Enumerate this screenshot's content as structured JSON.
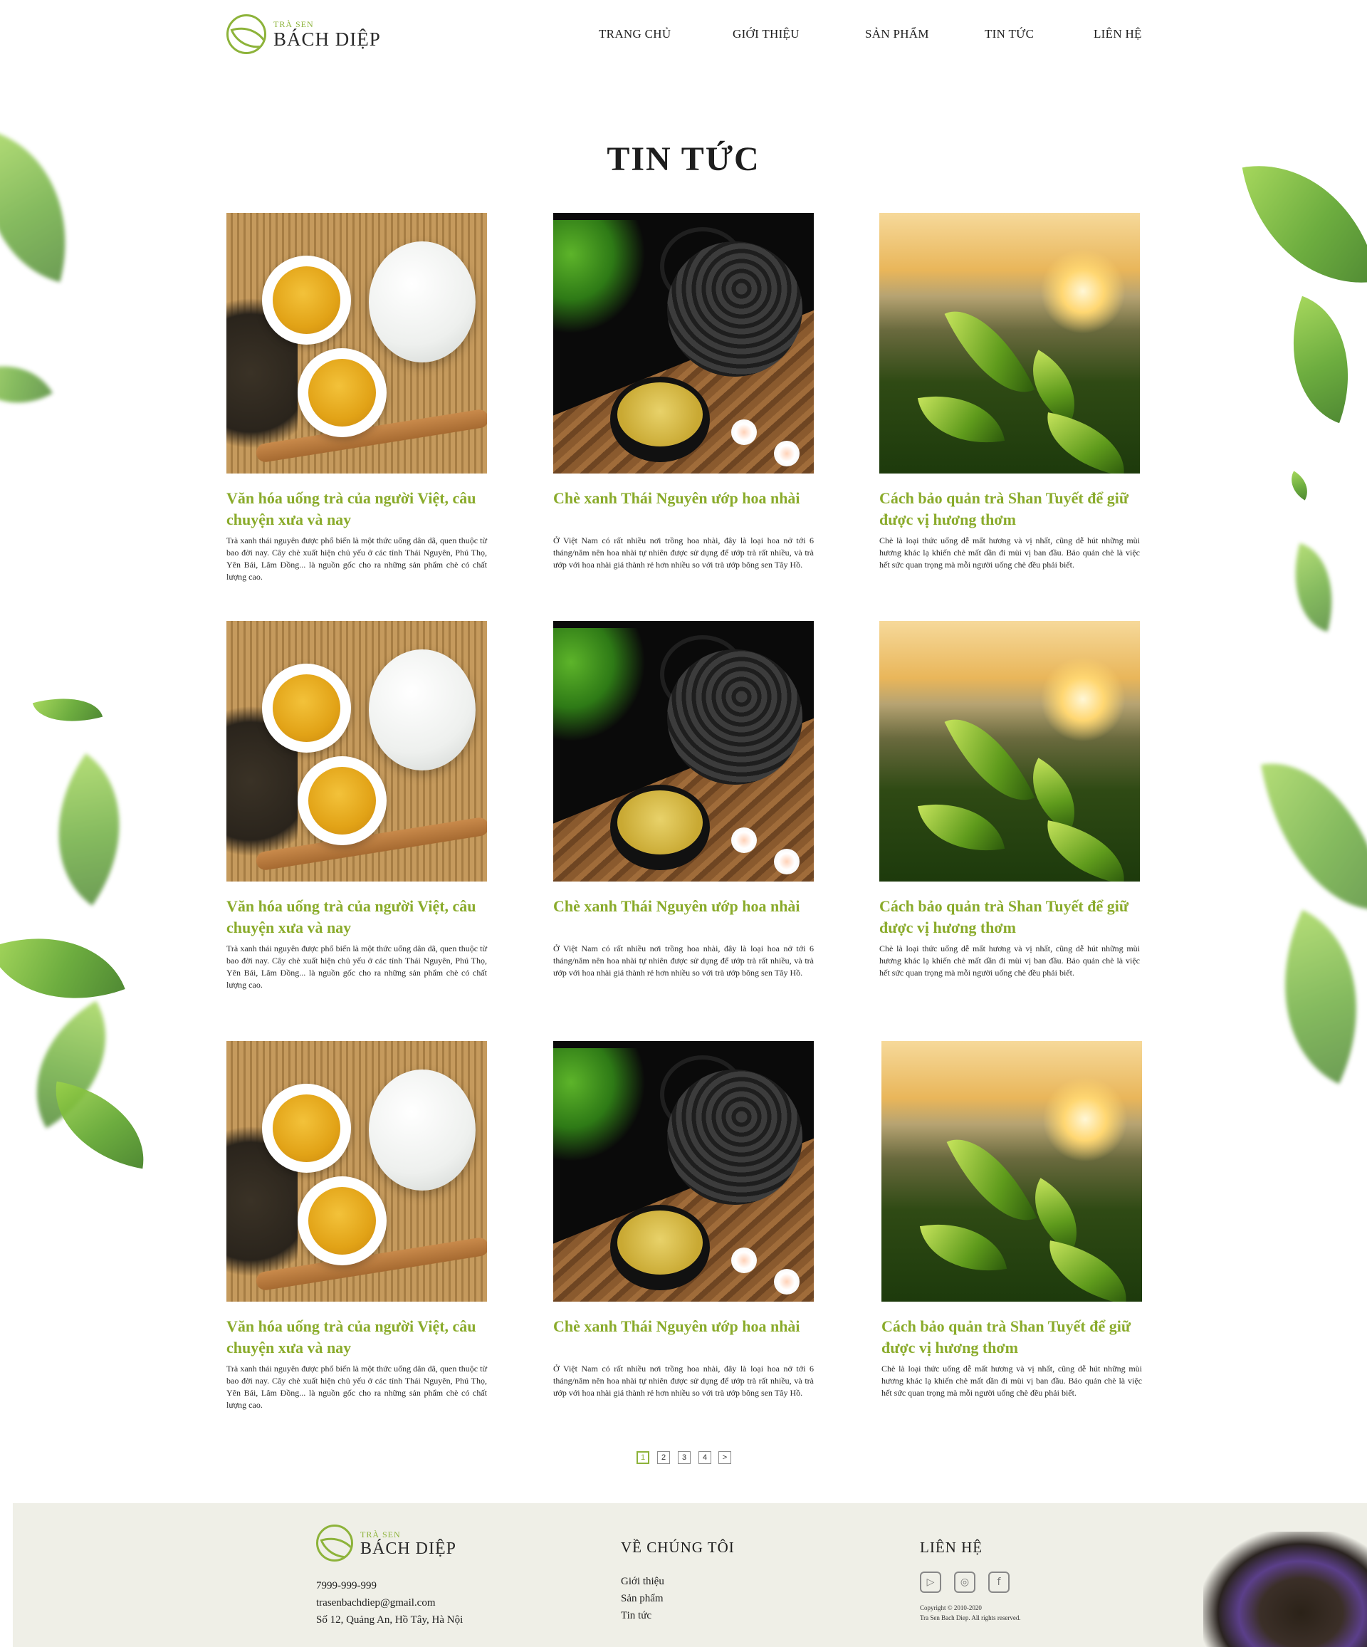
{
  "brand": {
    "small": "TRÀ SEN",
    "name": "BÁCH DIỆP"
  },
  "nav": [
    {
      "label": "TRANG CHỦ"
    },
    {
      "label": "GIỚI THIỆU"
    },
    {
      "label": "SẢN PHẨM"
    },
    {
      "label": "TIN TỨC"
    },
    {
      "label": "LIÊN HỆ"
    }
  ],
  "page_title": "TIN TỨC",
  "articles": [
    {
      "image": "tea-set-photo",
      "title": "Văn hóa uống trà của người Việt, câu chuyện xưa và nay",
      "desc": "Trà xanh thái nguyên được phổ biến là một thức uống dân dã, quen thuộc từ bao đời nay. Cây chè xuất hiện chủ yếu ở các tỉnh Thái Nguyên, Phú Thọ, Yên Bái, Lâm Đồng... là nguồn gốc cho ra những sản phẩm chè có chất lượng cao."
    },
    {
      "image": "black-teapot-photo",
      "title": "Chè xanh Thái Nguyên ướp hoa nhài",
      "desc": "Ở Việt Nam có rất nhiều nơi trồng hoa nhài, đây là loại hoa nở tới 6 tháng/năm nên hoa nhài tự nhiên được sử dụng để ướp trà rất nhiều, và trà ướp với hoa nhài giá thành rẻ hơn nhiều so với trà ướp bông sen Tây Hồ."
    },
    {
      "image": "tea-field-photo",
      "title": "Cách bảo quản trà Shan Tuyết để giữ được vị hương thơm",
      "desc": "Chè là loại thức uống dễ mất hương và vị nhất, cũng dễ hút những mùi hương khác lạ khiến chè mất dần đi mùi vị ban đầu. Bảo quản chè là việc hết sức quan trọng mà mỗi người uống chè đều phải biết."
    },
    {
      "image": "tea-set-photo",
      "title": "Văn hóa uống trà của người Việt, câu chuyện xưa và nay",
      "desc": "Trà xanh thái nguyên được phổ biến là một thức uống dân dã, quen thuộc từ bao đời nay. Cây chè xuất hiện chủ yếu ở các tỉnh Thái Nguyên, Phú Thọ, Yên Bái, Lâm Đồng... là nguồn gốc cho ra những sản phẩm chè có chất lượng cao."
    },
    {
      "image": "black-teapot-photo",
      "title": "Chè xanh Thái Nguyên ướp hoa nhài",
      "desc": "Ở Việt Nam có rất nhiều nơi trồng hoa nhài, đây là loại hoa nở tới 6 tháng/năm nên hoa nhài tự nhiên được sử dụng để ướp trà rất nhiều, và trà ướp với hoa nhài giá thành rẻ hơn nhiều so với trà ướp bông sen Tây Hồ."
    },
    {
      "image": "tea-field-photo",
      "title": "Cách bảo quản trà Shan Tuyết để giữ được vị hương thơm",
      "desc": "Chè là loại thức uống dễ mất hương và vị nhất, cũng dễ hút những mùi hương khác lạ khiến chè mất dần đi mùi vị ban đầu. Bảo quản chè là việc hết sức quan trọng mà mỗi người uống chè đều phải biết."
    },
    {
      "image": "tea-set-photo",
      "title": "Văn hóa uống trà của người Việt, câu chuyện xưa và nay",
      "desc": "Trà xanh thái nguyên được phổ biến là một thức uống dân dã, quen thuộc từ bao đời nay. Cây chè xuất hiện chủ yếu ở các tỉnh Thái Nguyên, Phú Thọ, Yên Bái, Lâm Đồng... là nguồn gốc cho ra những sản phẩm chè có chất lượng cao."
    },
    {
      "image": "black-teapot-photo",
      "title": "Chè xanh Thái Nguyên ướp hoa nhài",
      "desc": "Ở Việt Nam có rất nhiều nơi trồng hoa nhài, đây là loại hoa nở tới 6 tháng/năm nên hoa nhài tự nhiên được sử dụng để ướp trà rất nhiều, và trà ướp với hoa nhài giá thành rẻ hơn nhiều so với trà ướp bông sen Tây Hồ."
    },
    {
      "image": "tea-field-photo",
      "title": "Cách bảo quản trà Shan Tuyết để giữ được vị hương thơm",
      "desc": "Chè là loại thức uống dễ mất hương và vị nhất, cũng dễ hút những mùi hương khác lạ khiến chè mất dần đi mùi vị ban đầu. Bảo quản chè là việc hết sức quan trọng mà mỗi người uống chè đều phải biết."
    }
  ],
  "pagination": {
    "pages": [
      "1",
      "2",
      "3",
      "4"
    ],
    "next": ">",
    "current": "1"
  },
  "footer": {
    "phone": "7999-999-999",
    "email": "trasenbachdiep@gmail.com",
    "address": "Số 12, Quảng An, Hồ Tây, Hà Nội",
    "about_heading": "VỀ CHÚNG TÔI",
    "about_links": [
      "Giới thiệu",
      "Sản phẩm",
      "Tin tức"
    ],
    "contact_heading": "LIÊN HỆ",
    "socials": [
      "youtube-icon",
      "instagram-icon",
      "facebook-icon"
    ],
    "copyright": "Copyright © 2010-2020",
    "rights": "Tra Sen Bach Diep. All rights reserved."
  },
  "colors": {
    "accent": "#8aab2b",
    "footer_bg": "#efefe7",
    "text": "#1e1e1e"
  }
}
